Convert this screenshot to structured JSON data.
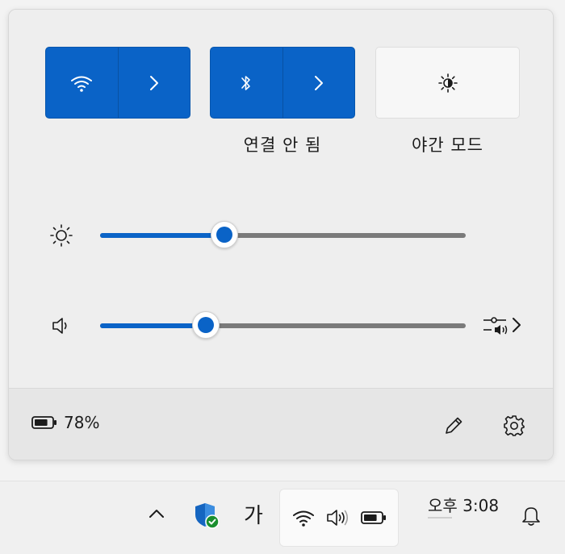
{
  "quick_settings": {
    "tiles": [
      {
        "id": "wifi",
        "state": "on",
        "label": ""
      },
      {
        "id": "bluetooth",
        "state": "on",
        "label": "연결 안 됨"
      },
      {
        "id": "night-light",
        "state": "off",
        "label": "야간 모드"
      }
    ],
    "brightness": {
      "value_percent": 34
    },
    "volume": {
      "value_percent": 29
    },
    "battery": {
      "percent_text": "78%",
      "level": 0.78
    }
  },
  "taskbar": {
    "ime_label": "가",
    "clock_time": "오후 3:08"
  },
  "colors": {
    "accent": "#0a63c7",
    "panel_bg": "#eeeeee",
    "footer_bg": "#e6e6e6",
    "track": "#7a7a7a",
    "defender_green": "#1a8f2e"
  },
  "icons": {
    "wifi": "wifi-icon",
    "bluetooth": "bluetooth-icon",
    "night_light": "night-light-icon",
    "brightness": "sun-icon",
    "volume": "speaker-icon",
    "mixer": "audio-mixer-icon",
    "battery": "battery-icon",
    "edit": "pencil-icon",
    "settings": "gear-icon",
    "bell": "bell-icon"
  }
}
